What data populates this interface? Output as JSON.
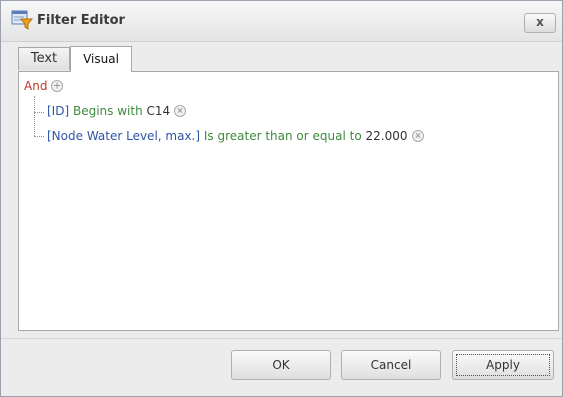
{
  "window": {
    "title": "Filter Editor",
    "close_label": "x",
    "icon": "filter-editor-icon"
  },
  "tabs": [
    {
      "label": "Text",
      "active": false
    },
    {
      "label": "Visual",
      "active": true
    }
  ],
  "filter": {
    "group_operator": "And",
    "conditions": [
      {
        "field": "[ID]",
        "operator": "Begins with",
        "value": "C14"
      },
      {
        "field": "[Node Water Level, max.]",
        "operator": "Is greater than or equal to",
        "value": "22.000"
      }
    ]
  },
  "buttons": {
    "ok": "OK",
    "cancel": "Cancel",
    "apply": "Apply"
  },
  "colors": {
    "group": "#c0392b",
    "field": "#2e55a8",
    "operator": "#3f8a3f"
  }
}
